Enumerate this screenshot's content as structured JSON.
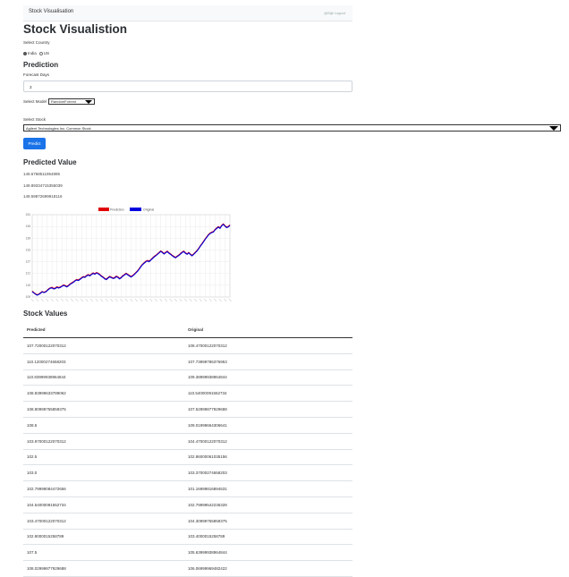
{
  "navbar": {
    "brand": "Stock Visualisation",
    "user": "@Bijit Logout"
  },
  "page_title": "Stock Visualistion",
  "country": {
    "label": "Select Country",
    "options": [
      {
        "label": "India",
        "selected": true
      },
      {
        "label": "US",
        "selected": false
      }
    ]
  },
  "prediction": {
    "heading": "Prediction",
    "forecast_label": "Forecast Days",
    "forecast_value": "3",
    "model_label": "Select Model",
    "model_value": "RandomForrest",
    "stock_label": "Select Stock",
    "stock_value": "Agilent Technologies Inc. Common Stock",
    "button": "Predict"
  },
  "predicted": {
    "heading": "Predicted Value",
    "values": [
      "149.6768511954895",
      "149.89334715355039",
      "149.59872699918116"
    ]
  },
  "chart_data": {
    "type": "line",
    "title": "",
    "legend": [
      "Prediction",
      "Original"
    ],
    "legend_position": "top-center",
    "colors": {
      "Prediction": "#e00000",
      "Original": "#0000dd"
    },
    "ylim": [
      106,
      151
    ],
    "yticks": [
      "151",
      "145",
      "139",
      "133",
      "127",
      "121",
      "115",
      "109"
    ],
    "grid": true,
    "series": [
      {
        "name": "Prediction",
        "values": [
          109.2,
          108.4,
          107.8,
          107.2,
          107.6,
          108.3,
          109.0,
          108.6,
          108.9,
          109.6,
          110.5,
          111.0,
          111.3,
          110.7,
          110.9,
          111.6,
          111.2,
          111.5,
          112.0,
          112.6,
          112.3,
          111.8,
          112.4,
          113.2,
          113.8,
          114.3,
          115.0,
          115.6,
          115.3,
          115.9,
          116.6,
          117.2,
          117.0,
          117.8,
          118.3,
          117.8,
          118.6,
          119.2,
          118.7,
          119.4,
          119.0,
          118.4,
          117.6,
          117.0,
          116.2,
          115.8,
          116.6,
          117.3,
          116.9,
          116.4,
          116.6,
          117.4,
          117.0,
          116.2,
          116.8,
          117.7,
          118.3,
          119.0,
          118.4,
          117.8,
          117.2,
          117.8,
          118.6,
          119.5,
          120.4,
          121.6,
          122.9,
          124.0,
          124.8,
          125.6,
          126.0,
          125.6,
          126.5,
          127.3,
          128.2,
          128.8,
          129.6,
          130.4,
          131.2,
          130.6,
          129.8,
          130.5,
          131.1,
          130.2,
          129.6,
          128.8,
          128.2,
          127.7,
          128.4,
          129.0,
          129.8,
          130.6,
          131.1,
          130.2,
          129.6,
          130.4,
          129.5,
          128.8,
          129.6,
          130.5,
          131.4,
          132.6,
          134.0,
          135.2,
          136.5,
          137.8,
          139.0,
          140.2,
          141.0,
          141.5,
          141.8,
          143.0,
          143.8,
          144.5,
          143.8,
          145.2,
          146.0,
          145.0,
          144.2,
          144.6,
          145.4
        ]
      },
      {
        "name": "Original",
        "values": [
          108.9,
          108.2,
          107.5,
          107.0,
          107.4,
          108.0,
          108.8,
          108.4,
          108.6,
          109.4,
          110.2,
          110.8,
          111.0,
          110.4,
          110.6,
          111.3,
          110.9,
          111.2,
          111.8,
          112.3,
          112.0,
          111.5,
          112.1,
          112.9,
          113.5,
          114.0,
          114.8,
          115.3,
          115.0,
          115.6,
          116.3,
          116.9,
          116.7,
          117.5,
          118.0,
          117.5,
          118.3,
          118.9,
          118.4,
          119.1,
          118.7,
          118.1,
          117.3,
          116.7,
          115.9,
          115.5,
          116.3,
          117.0,
          116.6,
          116.1,
          116.3,
          117.1,
          116.7,
          115.9,
          116.5,
          117.4,
          118.0,
          118.7,
          118.1,
          117.5,
          116.9,
          117.5,
          118.3,
          119.2,
          120.1,
          121.3,
          122.6,
          123.7,
          124.5,
          125.3,
          125.7,
          125.3,
          126.2,
          127.0,
          127.9,
          128.5,
          129.3,
          130.1,
          130.9,
          130.3,
          129.5,
          130.2,
          130.8,
          129.9,
          129.3,
          128.5,
          127.9,
          127.4,
          128.1,
          128.7,
          129.5,
          130.3,
          130.8,
          129.9,
          129.3,
          130.1,
          129.2,
          128.5,
          129.3,
          130.2,
          131.1,
          132.3,
          133.7,
          134.9,
          136.2,
          137.5,
          138.7,
          139.9,
          140.7,
          141.2,
          141.5,
          142.7,
          143.5,
          144.2,
          143.5,
          144.9,
          145.7,
          144.7,
          143.9,
          144.3,
          145.1
        ]
      }
    ]
  },
  "stock_values": {
    "heading": "Stock Values",
    "columns": [
      "Predicted",
      "Original"
    ],
    "rows": [
      [
        "107.72000122070312",
        "108.47000122070312"
      ],
      [
        "110.12000274658203",
        "107.73999786376953"
      ],
      [
        "110.83999938964844",
        "109.38999938964844"
      ],
      [
        "108.83999633789062",
        "110.54000091552734"
      ],
      [
        "108.80999755859375",
        "107.52999877929688"
      ],
      [
        "108.5",
        "109.01999664306641"
      ],
      [
        "103.97000122070312",
        "104.47000122070312"
      ],
      [
        "102.5",
        "102.86000061035156"
      ],
      [
        "103.0",
        "103.37000274658203"
      ],
      [
        "102.79999084472656",
        "101.16999816894531"
      ],
      [
        "104.54000091552734",
        "102.79999542236328"
      ],
      [
        "103.47000122070312",
        "104.30999755859375"
      ],
      [
        "102.9000015258789",
        "103.4000015258789"
      ],
      [
        "107.5",
        "105.63999938964844"
      ],
      [
        "108.02999877929688",
        "106.06999969482422"
      ]
    ]
  }
}
